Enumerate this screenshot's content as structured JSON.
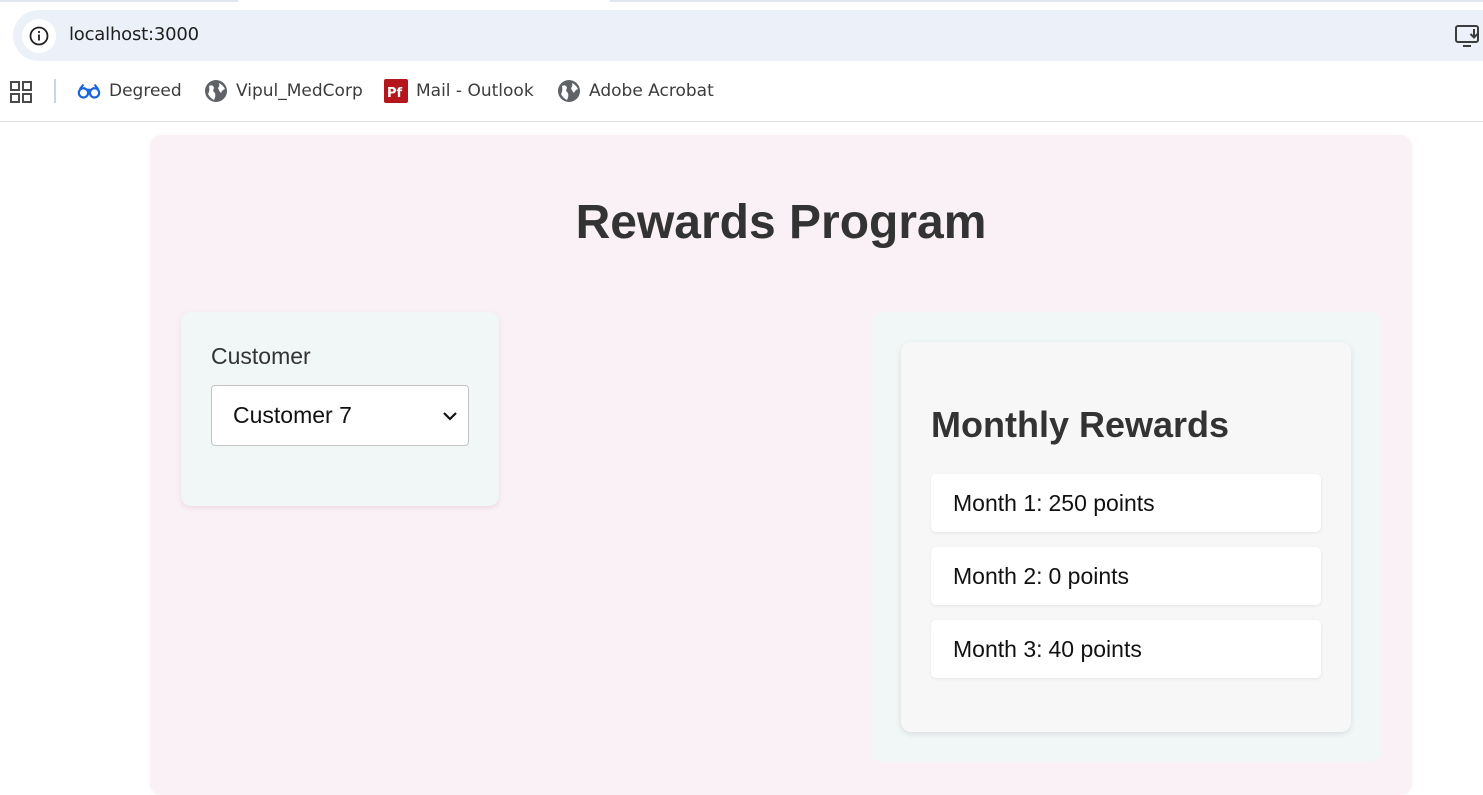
{
  "browser": {
    "url": "localhost:3000",
    "bookmarks": [
      {
        "label": "Degreed",
        "icon": "glasses-icon",
        "color": "#1a66d6"
      },
      {
        "label": "Vipul_MedCorp",
        "icon": "globe-icon",
        "color": "#5f6368"
      },
      {
        "label": "Mail - Outlook",
        "icon": "pdf-icon",
        "color": "#b3161b"
      },
      {
        "label": "Adobe Acrobat",
        "icon": "globe-icon",
        "color": "#5f6368"
      }
    ]
  },
  "app": {
    "title": "Rewards Program",
    "background_color": "#f9f1f5",
    "customer": {
      "label": "Customer",
      "selected": "Customer 7"
    },
    "monthly_rewards": {
      "title": "Monthly Rewards",
      "months": [
        {
          "label": "Month 1:",
          "points": "250 points"
        },
        {
          "label": "Month 2:",
          "points": "0 points"
        },
        {
          "label": "Month 3:",
          "points": "40 points"
        }
      ]
    }
  }
}
